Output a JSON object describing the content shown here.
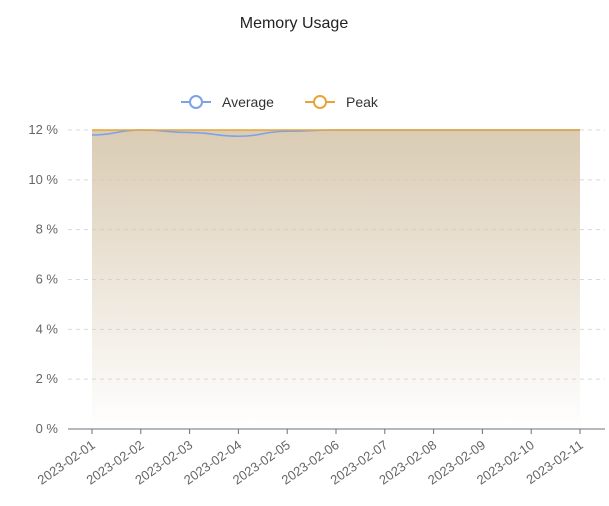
{
  "chart_data": {
    "type": "area",
    "title": "Memory Usage",
    "x": [
      "2023-02-01",
      "2023-02-02",
      "2023-02-03",
      "2023-02-04",
      "2023-02-05",
      "2023-02-06",
      "2023-02-07",
      "2023-02-08",
      "2023-02-09",
      "2023-02-10",
      "2023-02-11"
    ],
    "series": [
      {
        "name": "Average",
        "color": "#7ba2e8",
        "values": [
          11.8,
          12.0,
          11.9,
          11.75,
          11.95,
          12.0,
          12.0,
          12.0,
          12.0,
          12.0,
          12.0
        ]
      },
      {
        "name": "Peak",
        "color": "#e7a43a",
        "values": [
          12.0,
          12.0,
          12.0,
          12.0,
          12.0,
          12.0,
          12.0,
          12.0,
          12.0,
          12.0,
          12.0
        ]
      }
    ],
    "y_ticks": [
      0,
      2,
      4,
      6,
      8,
      10,
      12
    ],
    "y_tick_suffix": " %",
    "ylim": [
      0,
      12
    ],
    "grid": true,
    "legend_position": "top-center",
    "area_fill_color": "#d8c9b0",
    "xlabel": "",
    "ylabel": ""
  }
}
